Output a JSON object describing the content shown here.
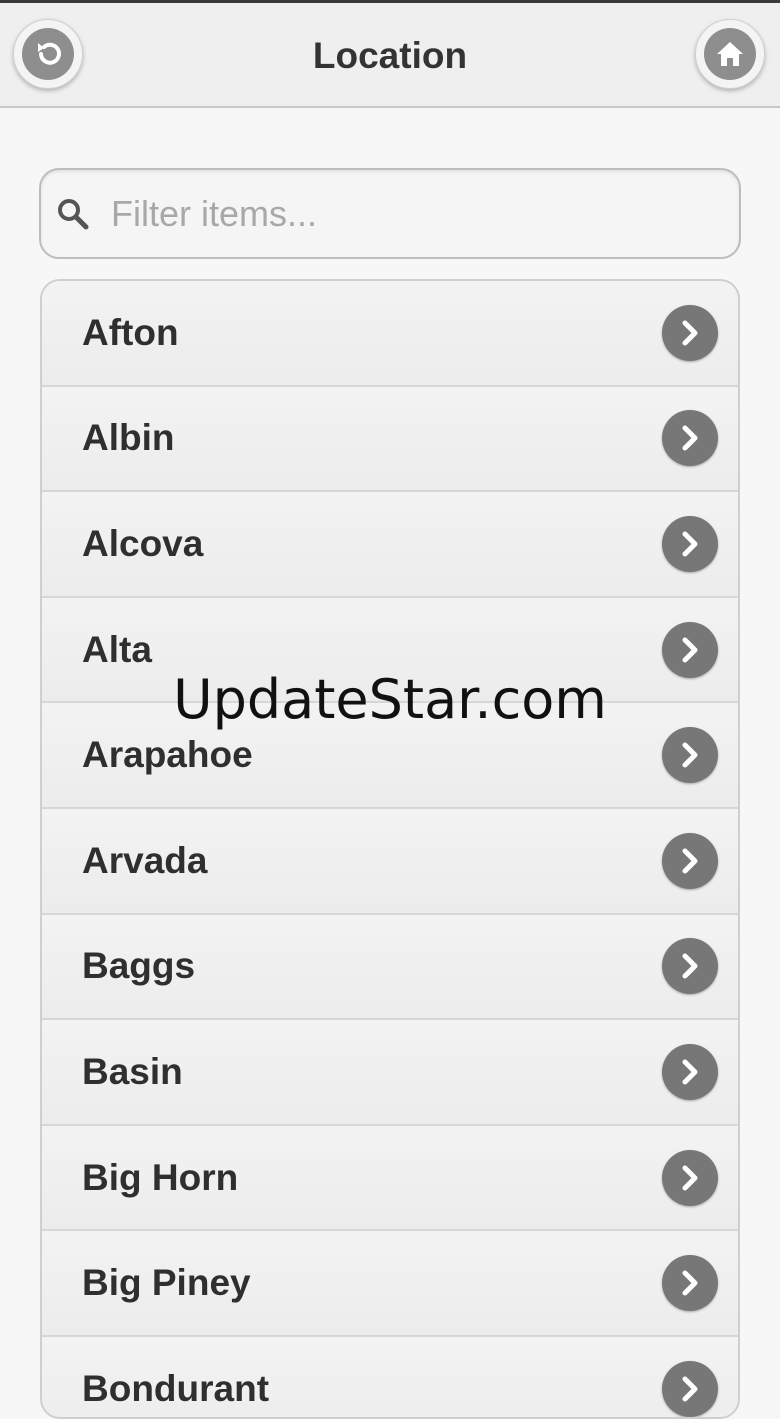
{
  "header": {
    "title": "Location",
    "back_icon": "back-icon",
    "home_icon": "home-icon"
  },
  "search": {
    "placeholder": "Filter items...",
    "value": "",
    "icon": "search-icon"
  },
  "list": {
    "items": [
      {
        "label": "Afton"
      },
      {
        "label": "Albin"
      },
      {
        "label": "Alcova"
      },
      {
        "label": "Alta"
      },
      {
        "label": "Arapahoe"
      },
      {
        "label": "Arvada"
      },
      {
        "label": "Baggs"
      },
      {
        "label": "Basin"
      },
      {
        "label": "Big Horn"
      },
      {
        "label": "Big Piney"
      },
      {
        "label": "Bondurant"
      }
    ],
    "item_icon": "chevron-right-icon"
  },
  "watermark": "UpdateStar.com",
  "colors": {
    "header_bg": "#efefef",
    "icon_gray": "#777777",
    "text": "#2f2f2f"
  }
}
